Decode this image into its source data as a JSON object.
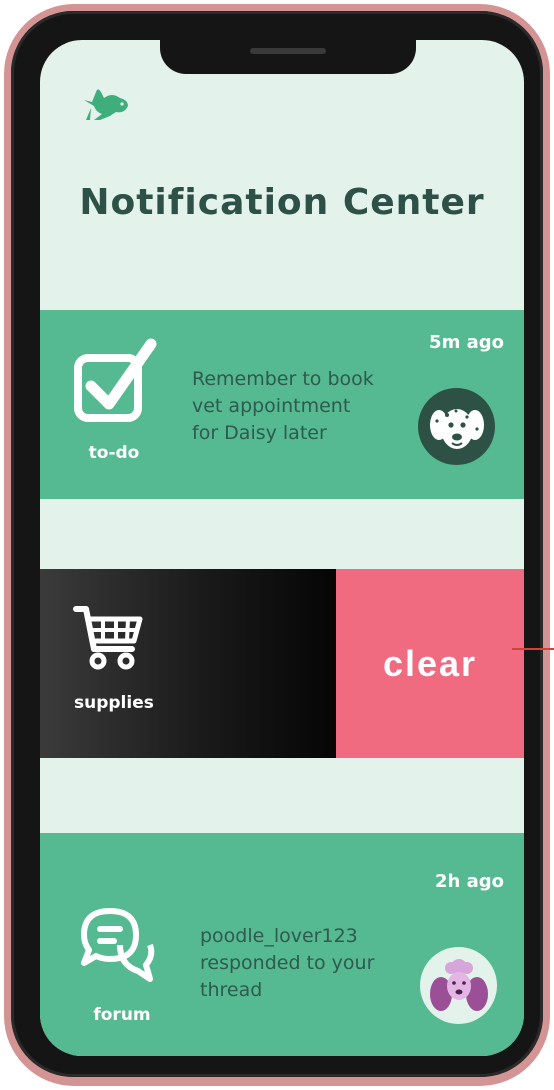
{
  "header": {
    "title": "Notification Center",
    "logo_icon": "rabbit-icon"
  },
  "notifications": [
    {
      "category": "to-do",
      "icon": "checkbox-icon",
      "time": "5m ago",
      "lines": [
        "Remember to book",
        "vet appointment",
        "for Daisy later"
      ],
      "avatar": "dalmatian-icon"
    },
    {
      "category": "supplies",
      "icon": "shopping-cart-icon",
      "action": "clear"
    },
    {
      "category": "forum",
      "icon": "chat-bubbles-icon",
      "time": "2h ago",
      "lines": [
        "poodle_lover123",
        "responded to your",
        "thread"
      ],
      "avatar": "poodle-icon"
    }
  ],
  "colors": {
    "background": "#e4f2ec",
    "card": "#55b991",
    "title": "#2d5147",
    "message_text": "#2f5a4e",
    "clear": "#f06b80",
    "frame": "#d49494"
  }
}
